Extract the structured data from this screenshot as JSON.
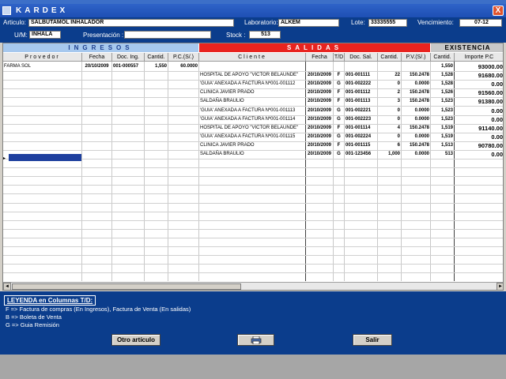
{
  "window": {
    "title": "KARDEX",
    "close_glyph": "X"
  },
  "form": {
    "articulo_label": "Articulo:",
    "articulo_value": "SALBUTAMOL INHALADOR",
    "laboratorio_label": "Laboratorio:",
    "laboratorio_value": "ALKEM",
    "lote_label": "Lote:",
    "lote_value": "33335555",
    "vencimiento_label": "Vencimiento:",
    "vencimiento_value": "07-12",
    "um_label": "U/M:",
    "um_value": "INHALA",
    "presentacion_label": "Presentación :",
    "presentacion_value": "",
    "stock_label": "Stock :",
    "stock_value": "513"
  },
  "grid": {
    "sections": {
      "ingresos": "INGRESOS",
      "salidas": "SALIDAS",
      "existencia": "EXISTENCIA"
    },
    "ingresos_headers": [
      "Provedor",
      "Fecha",
      "Doc. Ing.",
      "Cantid.",
      "P.C.(S/.)"
    ],
    "salidas_headers": [
      "Cliente",
      "Fecha",
      "T/D",
      "Doc. Sal.",
      "Cantid.",
      "P.V.(S/.)"
    ],
    "existencia_headers": [
      "Cantid.",
      "Importe P.C"
    ],
    "ingresos_rows": [
      [
        "FARMA SOL",
        "20/10/2009",
        "001-000557",
        "1,550",
        "60.0000"
      ]
    ],
    "salidas_rows": [
      [
        "",
        "",
        "",
        "",
        "",
        ""
      ],
      [
        "HOSPITAL DE APOYO \"VICTOR BELAUNDE\"",
        "20/10/2009",
        "F",
        "001-001111",
        "22",
        "150.2478"
      ],
      [
        "'GUIA' ANEXADA A FACTURA Nº001-001112",
        "20/10/2009",
        "G",
        "001-002222",
        "0",
        "0.0000"
      ],
      [
        "CLINICA JAVIER PRADO",
        "20/10/2009",
        "F",
        "001-001112",
        "2",
        "150.2478"
      ],
      [
        "SALDAÑA BRAULIO",
        "20/10/2009",
        "F",
        "001-001113",
        "3",
        "150.2478"
      ],
      [
        "'GUIA' ANEXADA A FACTURA Nº001-001113",
        "20/10/2009",
        "G",
        "001-002221",
        "0",
        "0.0000"
      ],
      [
        "'GUIA' ANEXADA A FACTURA Nº001-001114",
        "20/10/2009",
        "G",
        "001-002223",
        "0",
        "0.0000"
      ],
      [
        "HOSPITAL DE APOYO \"VICTOR BELAUNDE\"",
        "20/10/2009",
        "F",
        "001-001114",
        "4",
        "150.2478"
      ],
      [
        "'GUIA' ANEXADA A FACTURA Nº001-001115",
        "20/10/2009",
        "G",
        "001-002224",
        "0",
        "0.0000"
      ],
      [
        "CLINICA JAVIER PRADO",
        "20/10/2009",
        "F",
        "001-001115",
        "6",
        "150.2478"
      ],
      [
        "SALDAÑA BRAULIO",
        "20/10/2009",
        "G",
        "001-123456",
        "1,000",
        "0.0000"
      ]
    ],
    "existencia_rows": [
      [
        "1,550",
        "93000.00"
      ],
      [
        "1,528",
        "91680.00"
      ],
      [
        "1,528",
        "0.00"
      ],
      [
        "1,526",
        "91560.00"
      ],
      [
        "1,523",
        "91380.00"
      ],
      [
        "1,523",
        "0.00"
      ],
      [
        "1,523",
        "0.00"
      ],
      [
        "1,519",
        "91140.00"
      ],
      [
        "1,519",
        "0.00"
      ],
      [
        "1,513",
        "90780.00"
      ],
      [
        "513",
        "0.00"
      ]
    ],
    "row_indicator": "▸",
    "scroll_left": "◄",
    "scroll_right": "►"
  },
  "legend": {
    "title": "LEYENDA en Columnas T/D:",
    "lines": [
      "F => Factura de compras (En Ingresos), Factura de Venta (En salidas)",
      "B => Boleta de Venta",
      "G => Guia Remisión"
    ]
  },
  "buttons": {
    "otro": "Otro artículo",
    "print_icon": "printer-icon",
    "salir": "Salir"
  },
  "colors": {
    "form_bg": "#0b3d8c",
    "ingresos_header": "#a6c8ee",
    "salidas_header": "#e8231f",
    "existencia_header": "#c8c8c8",
    "selected": "#1e3f9e"
  }
}
